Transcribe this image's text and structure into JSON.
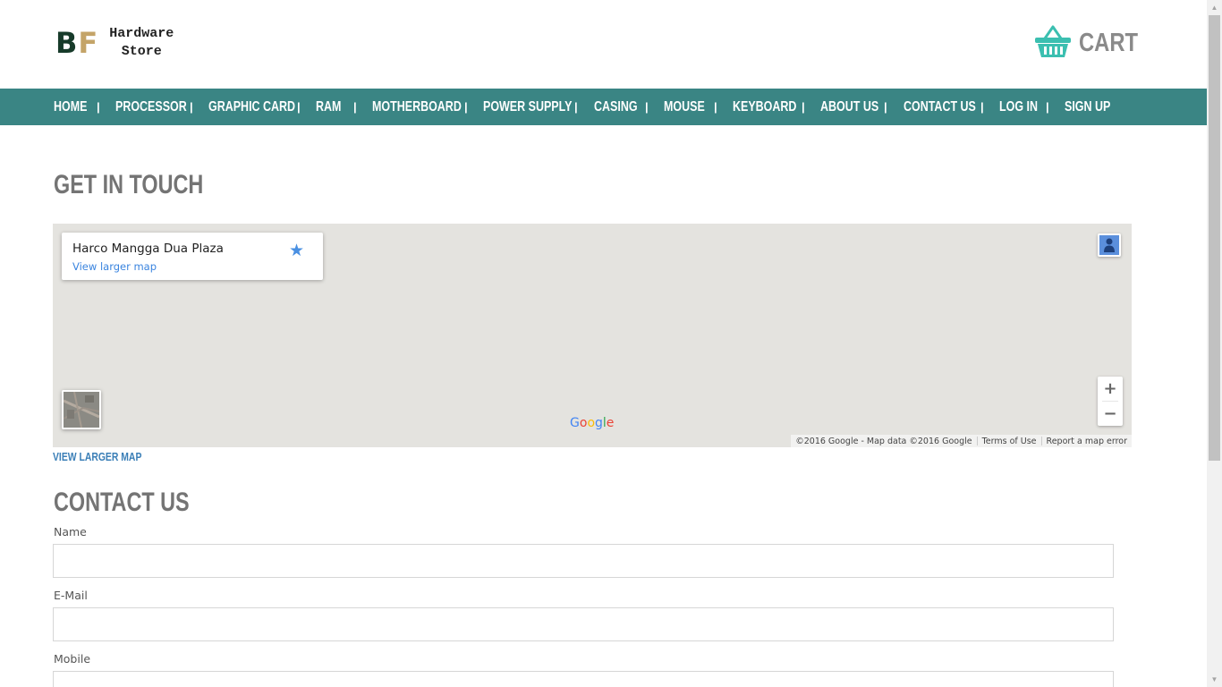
{
  "header": {
    "logo_b": "B",
    "logo_f": "F",
    "logo_line1": "Hardware",
    "logo_line2": "Store",
    "cart_label": "CART",
    "cart_icon": "basket-icon"
  },
  "nav": {
    "items": [
      "HOME",
      "PROCESSOR",
      "GRAPHIC CARD",
      "RAM",
      "MOTHERBOARD",
      "POWER SUPPLY",
      "CASING",
      "MOUSE",
      "KEYBOARD",
      "ABOUT US",
      "CONTACT US",
      "LOG IN",
      "SIGN UP"
    ],
    "separator": "|"
  },
  "get_in_touch": {
    "title": "GET IN TOUCH",
    "view_larger_map_link": "VIEW LARGER MAP"
  },
  "map": {
    "place_name": "Harco Mangga Dua Plaza",
    "view_larger_map": "View larger map",
    "star_icon": "star-icon",
    "pegman_icon": "pegman-icon",
    "zoom_in": "+",
    "zoom_out": "−",
    "google_logo": [
      "G",
      "o",
      "o",
      "g",
      "l",
      "e"
    ],
    "attribution": "©2016 Google - Map data ©2016 Google",
    "terms": "Terms of Use",
    "report": "Report a map error"
  },
  "contact": {
    "title": "CONTACT US",
    "name_label": "Name",
    "email_label": "E-Mail",
    "mobile_label": "Mobile",
    "name_value": "",
    "email_value": "",
    "mobile_value": ""
  },
  "colors": {
    "nav_bg": "#3a8584",
    "cart_icon": "#3bbfb0",
    "logo_b": "#173b2a",
    "logo_f": "#c4a468",
    "google": [
      "#4285f4",
      "#ea4335",
      "#fbbc05",
      "#4285f4",
      "#34a853",
      "#ea4335"
    ]
  }
}
